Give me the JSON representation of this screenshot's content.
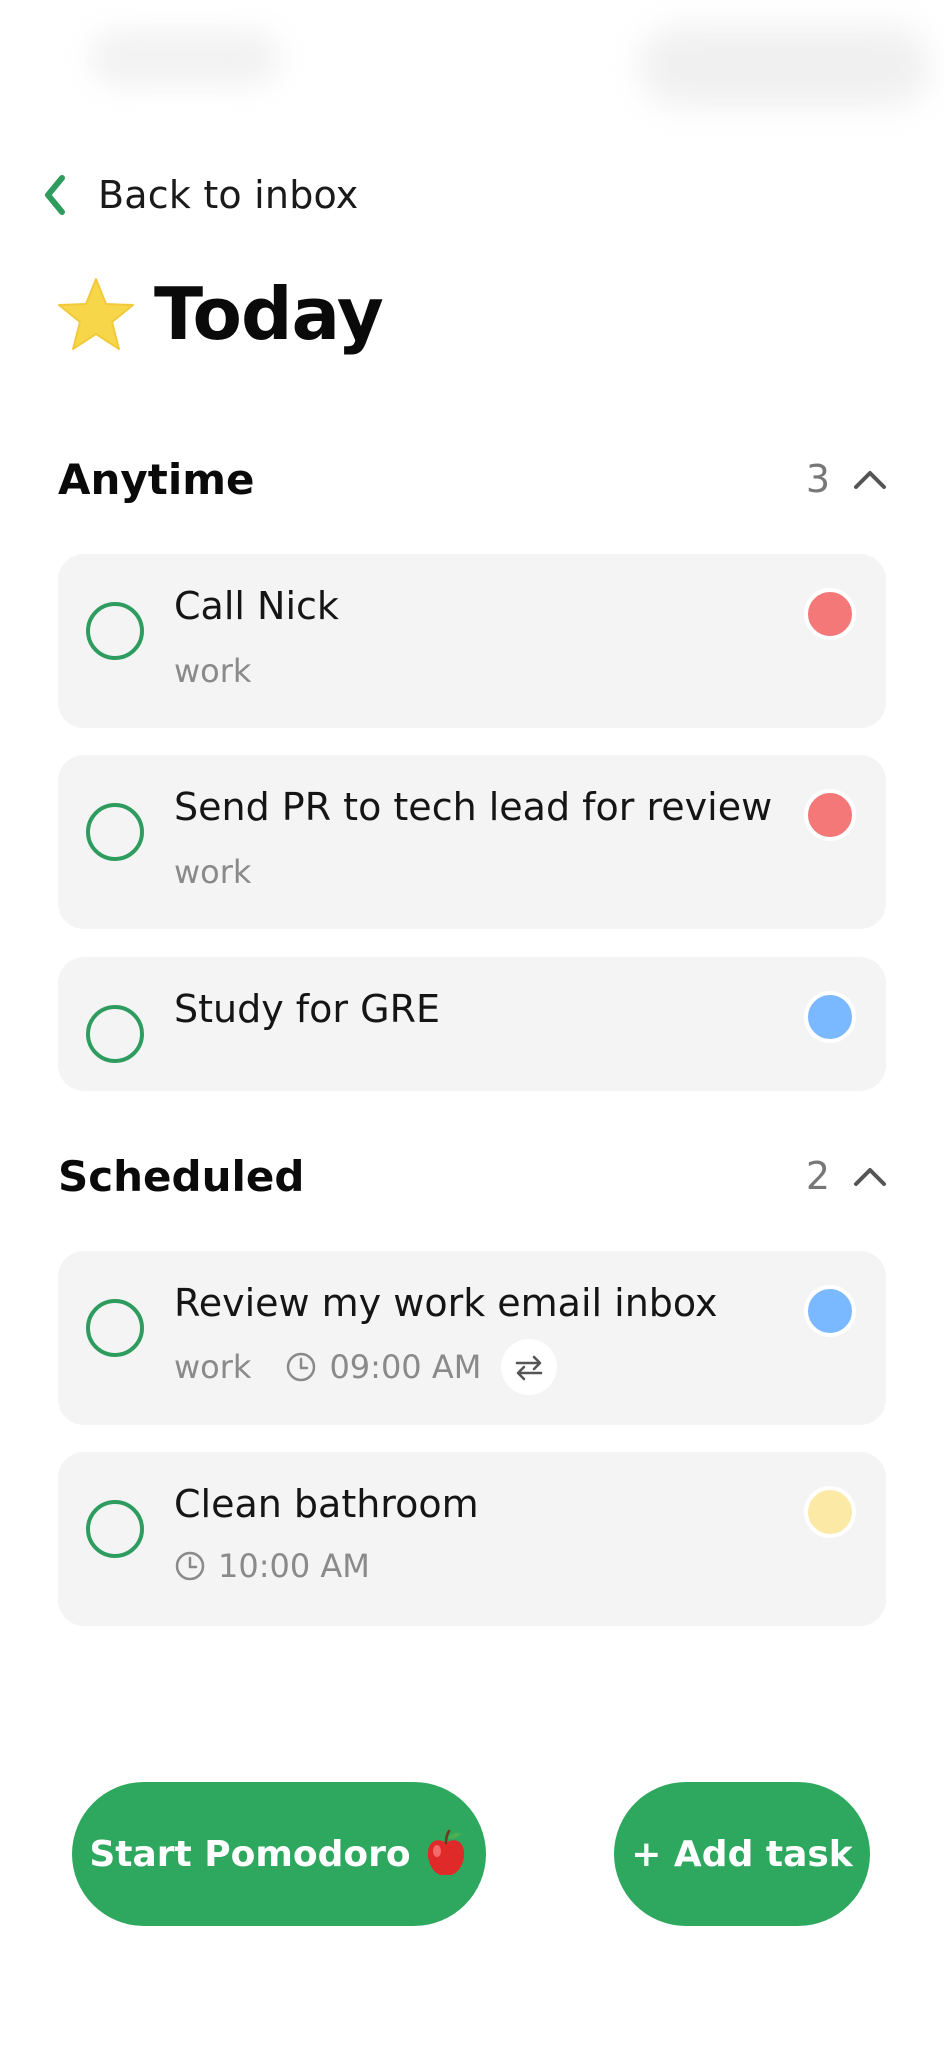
{
  "nav": {
    "back_label": "Back to inbox"
  },
  "page": {
    "title": "Today",
    "title_icon": "star-icon"
  },
  "sections": [
    {
      "title": "Anytime",
      "count": "3",
      "expanded": true
    },
    {
      "title": "Scheduled",
      "count": "2",
      "expanded": true
    }
  ],
  "tasks": [
    {
      "title": "Call Nick",
      "tag": "work",
      "priority_color": "#f47878"
    },
    {
      "title": "Send PR to tech lead for review",
      "tag": "work",
      "priority_color": "#f47878"
    },
    {
      "title": "Study for GRE",
      "priority_color": "#7ab8ff"
    },
    {
      "title": "Review my work email inbox",
      "tag": "work",
      "time": "09:00 AM",
      "repeat": true,
      "priority_color": "#7ab8ff"
    },
    {
      "title": "Clean bathroom",
      "time": "10:00 AM",
      "priority_color": "#fce9a6"
    }
  ],
  "actions": {
    "pomodoro_label": "Start Pomodoro",
    "pomodoro_icon": "apple-icon",
    "add_task_label": "+ Add task"
  },
  "colors": {
    "accent_green": "#2ea85e",
    "check_green": "#2e9c5f",
    "card_bg": "#f4f4f5",
    "star": "#f7d64a"
  }
}
